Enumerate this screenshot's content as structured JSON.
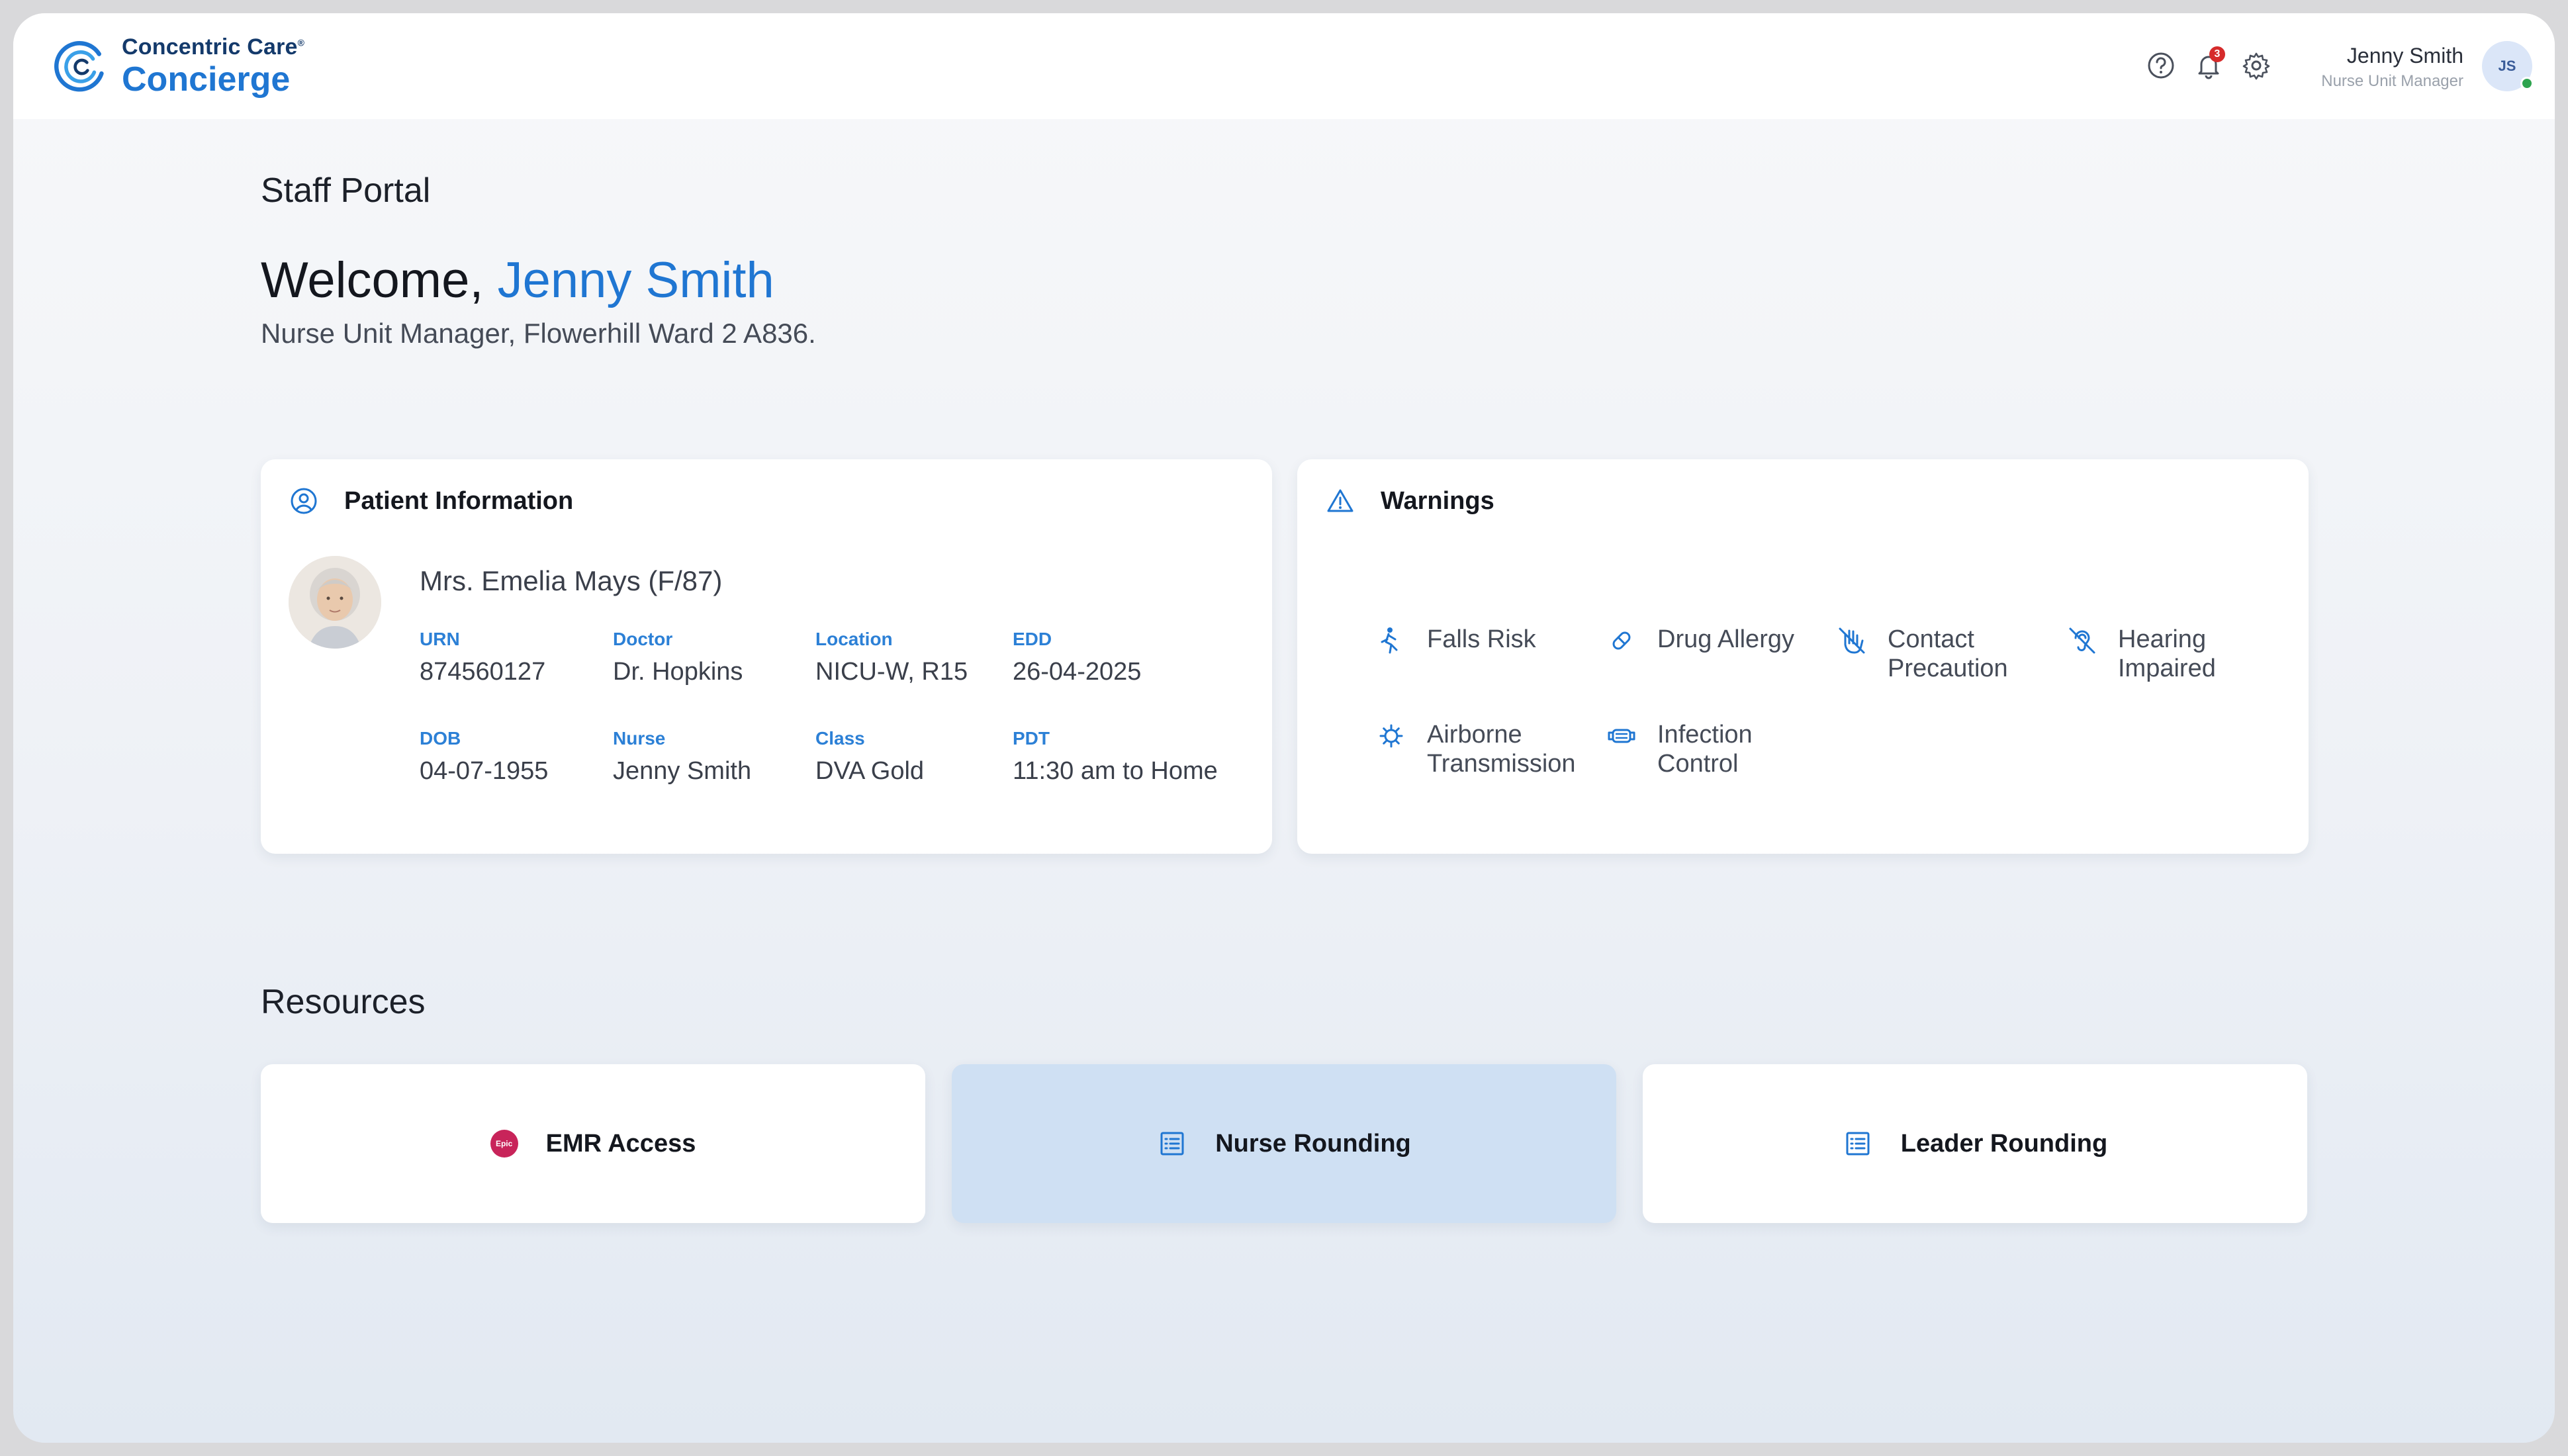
{
  "header": {
    "brand_top": "Concentric Care",
    "brand_trademark": "®",
    "brand_bottom": "Concierge",
    "notification_count": "3",
    "user_name": "Jenny Smith",
    "user_role": "Nurse Unit Manager",
    "user_initials": "JS"
  },
  "hero": {
    "portal_title": "Staff Portal",
    "welcome_prefix": "Welcome,",
    "welcome_name": "Jenny Smith",
    "subtitle": "Nurse Unit Manager, Flowerhill Ward 2 A836."
  },
  "patient": {
    "card_title": "Patient Information",
    "name": "Mrs. Emelia Mays (F/87)",
    "fields": [
      {
        "label": "URN",
        "value": "874560127"
      },
      {
        "label": "Doctor",
        "value": "Dr. Hopkins"
      },
      {
        "label": "Location",
        "value": "NICU-W, R15"
      },
      {
        "label": "EDD",
        "value": "26-04-2025"
      },
      {
        "label": "DOB",
        "value": "04-07-1955"
      },
      {
        "label": "Nurse",
        "value": "Jenny Smith"
      },
      {
        "label": "Class",
        "value": "DVA Gold"
      },
      {
        "label": "PDT",
        "value": "11:30 am to Home"
      }
    ]
  },
  "warnings": {
    "card_title": "Warnings",
    "items": [
      {
        "line1": "Falls Risk",
        "line2": "",
        "icon": "falls-risk-icon"
      },
      {
        "line1": "Drug Allergy",
        "line2": "",
        "icon": "pill-icon"
      },
      {
        "line1": "Contact",
        "line2": "Precaution",
        "icon": "no-touch-hand-icon"
      },
      {
        "line1": "Hearing",
        "line2": "Impaired",
        "icon": "hearing-impaired-icon"
      },
      {
        "line1": "Airborne",
        "line2": "Transmission",
        "icon": "virus-icon"
      },
      {
        "line1": "Infection",
        "line2": "Control",
        "icon": "mask-icon"
      }
    ]
  },
  "resources": {
    "title": "Resources",
    "epic_logo_text": "Epic",
    "tiles": [
      {
        "label": "EMR Access",
        "icon": "epic-logo-icon"
      },
      {
        "label": "Nurse Rounding",
        "icon": "list-document-icon"
      },
      {
        "label": "Leader Rounding",
        "icon": "list-document-icon"
      }
    ]
  },
  "colors": {
    "accent": "#1f76d2",
    "label_blue": "#2c80d6",
    "active_tile": "#cfe0f3",
    "epic": "#c8245a",
    "badge_red": "#d62b2b",
    "online": "#2ea44f"
  }
}
